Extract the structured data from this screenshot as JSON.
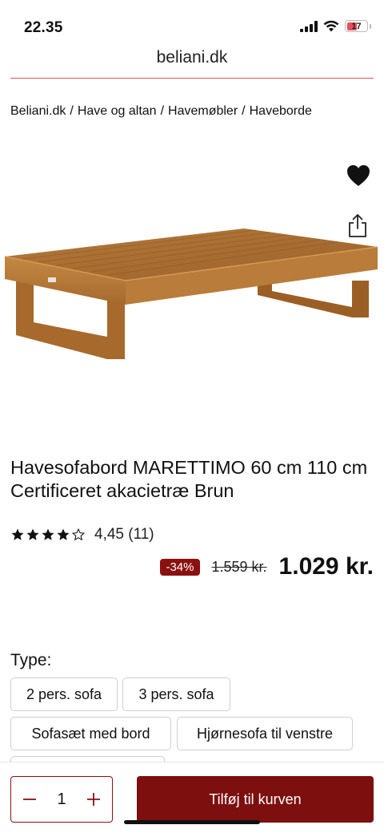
{
  "status_bar": {
    "time": "22.35",
    "battery_level": "17"
  },
  "browser": {
    "url": "beliani.dk"
  },
  "breadcrumb": [
    "Beliani.dk",
    "Have og altan",
    "Havemøbler",
    "Haveborde"
  ],
  "breadcrumb_separator": "/",
  "product": {
    "title": "Havesofabord MARETTIMO 60 cm 110 cm Certificeret akacietræ Brun",
    "rating_value": 4.45,
    "rating_text": "4,45 (11)",
    "discount": "-34%",
    "old_price": "1.559 kr.",
    "price": "1.029 kr."
  },
  "type_section": {
    "label": "Type:",
    "options": [
      "2 pers. sofa",
      "3 pers. sofa",
      "Sofasæt med bord",
      "Hjørnesofa til venstre"
    ]
  },
  "cart": {
    "quantity": "1",
    "add_label": "Tilføj til kurven"
  },
  "colors": {
    "accent": "#7d0f0f",
    "badge": "#8b1111",
    "divider": "#d9524f"
  },
  "icons": [
    "signal-icon",
    "wifi-icon",
    "battery-icon",
    "heart-icon",
    "share-icon",
    "star-icon",
    "minus-icon",
    "plus-icon"
  ]
}
